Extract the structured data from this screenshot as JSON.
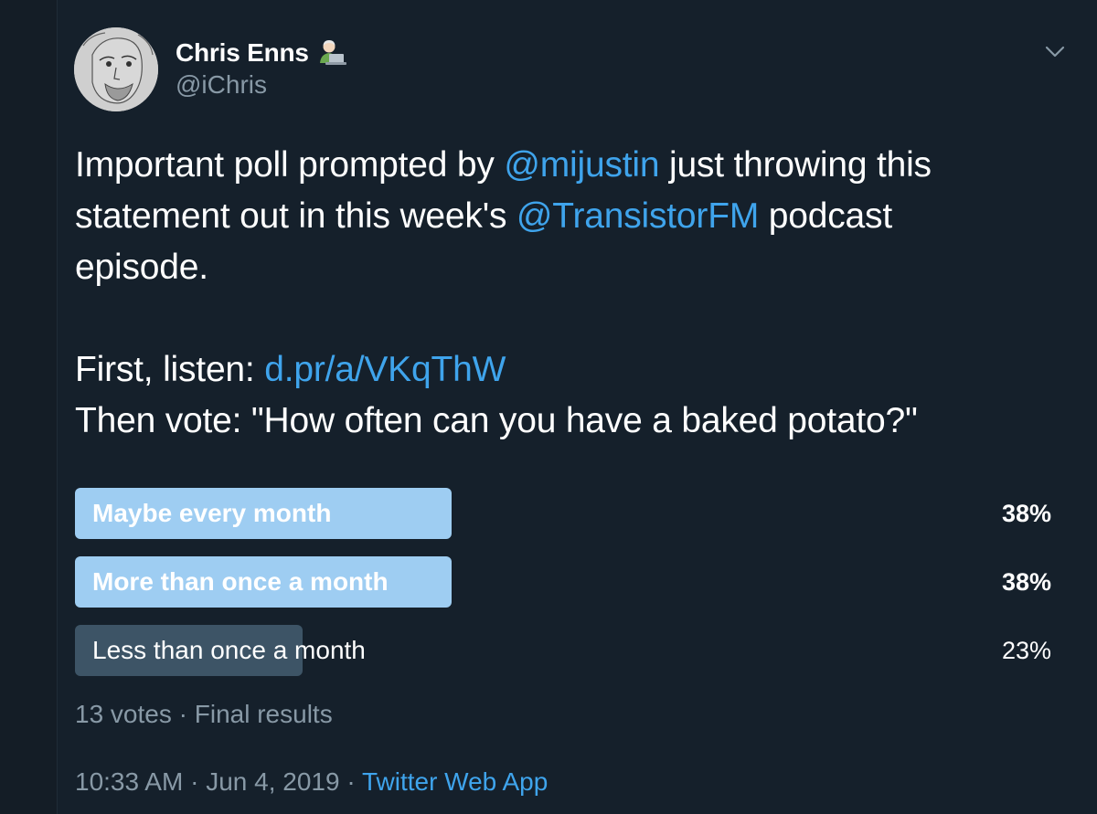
{
  "author": {
    "name": "Chris Enns",
    "handle": "@iChris"
  },
  "tweet": {
    "line1_a": "Important poll prompted by ",
    "line1_mention": "@mijustin",
    "line1_b": " just throwing this",
    "line2_a": "statement out in this week's ",
    "line2_mention": "@TransistorFM",
    "line2_b": " podcast",
    "line3": "episode.",
    "line4_a": "First, listen: ",
    "line4_link": "d.pr/a/VKqThW",
    "line5": "Then vote: \"How often can you have a baked potato?\""
  },
  "poll": {
    "options": [
      {
        "label": "Maybe every month",
        "percent": "38%",
        "value": 38,
        "winner": true
      },
      {
        "label": "More than once a month",
        "percent": "38%",
        "value": 38,
        "winner": true
      },
      {
        "label": "Less than once a month",
        "percent": "23%",
        "value": 23,
        "winner": false
      }
    ],
    "votes": "13 votes",
    "separator": " · ",
    "status": "Final results"
  },
  "meta": {
    "time": "10:33 AM",
    "separator": " · ",
    "date": "Jun 4, 2019",
    "source": "Twitter Web App"
  },
  "colors": {
    "background": "#15202b",
    "link": "#3fa4ec",
    "winner_bar": "#9ecdf2",
    "loser_bar": "#3d5466",
    "muted_text": "#8899a6"
  },
  "icons": {
    "caret": "chevron-down-icon",
    "emoji": "technologist-emoji-icon"
  }
}
